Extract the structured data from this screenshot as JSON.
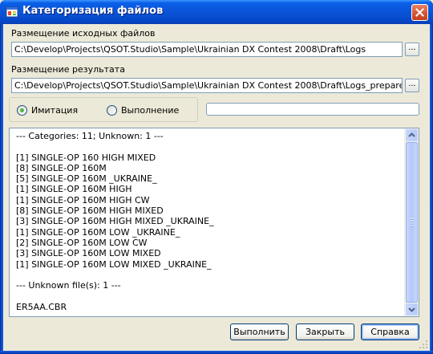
{
  "window": {
    "title": "Категоризация файлов",
    "accent_color": "#0a54d8"
  },
  "icons": {
    "app": "app-window-icon",
    "close": "close-icon",
    "browse": "ellipsis-icon",
    "scroll_up": "chevron-up-icon",
    "scroll_down": "chevron-down-icon",
    "grip": "resize-grip-icon"
  },
  "source": {
    "label": "Размещение исходных файлов",
    "value": "C:\\Develop\\Projects\\QSOT.Studio\\Sample\\Ukrainian DX Contest 2008\\Draft\\Logs",
    "browse_label": "..."
  },
  "result": {
    "label": "Размещение результата",
    "value": "C:\\Develop\\Projects\\QSOT.Studio\\Sample\\Ukrainian DX Contest 2008\\Draft\\Logs_prepared",
    "browse_label": "..."
  },
  "mode": {
    "options": [
      {
        "label": "Имитация",
        "checked": true
      },
      {
        "label": "Выполнение",
        "checked": false
      }
    ],
    "progress": 0
  },
  "output": {
    "text": "--- Categories: 11; Unknown: 1 ---\n\n[1] SINGLE-OP 160 HIGH MIXED\n[8] SINGLE-OP 160M\n[5] SINGLE-OP 160M _UKRAINE_\n[1] SINGLE-OP 160M HIGH\n[1] SINGLE-OP 160M HIGH CW\n[8] SINGLE-OP 160M HIGH MIXED\n[3] SINGLE-OP 160M HIGH MIXED _UKRAINE_\n[1] SINGLE-OP 160M LOW _UKRAINE_\n[2] SINGLE-OP 160M LOW CW\n[3] SINGLE-OP 160M LOW MIXED\n[1] SINGLE-OP 160M LOW MIXED _UKRAINE_\n\n--- Unknown file(s): 1 ---\n\nER5AA.CBR"
  },
  "buttons": {
    "run": "Выполнить",
    "close": "Закрыть",
    "help": "Справка"
  }
}
